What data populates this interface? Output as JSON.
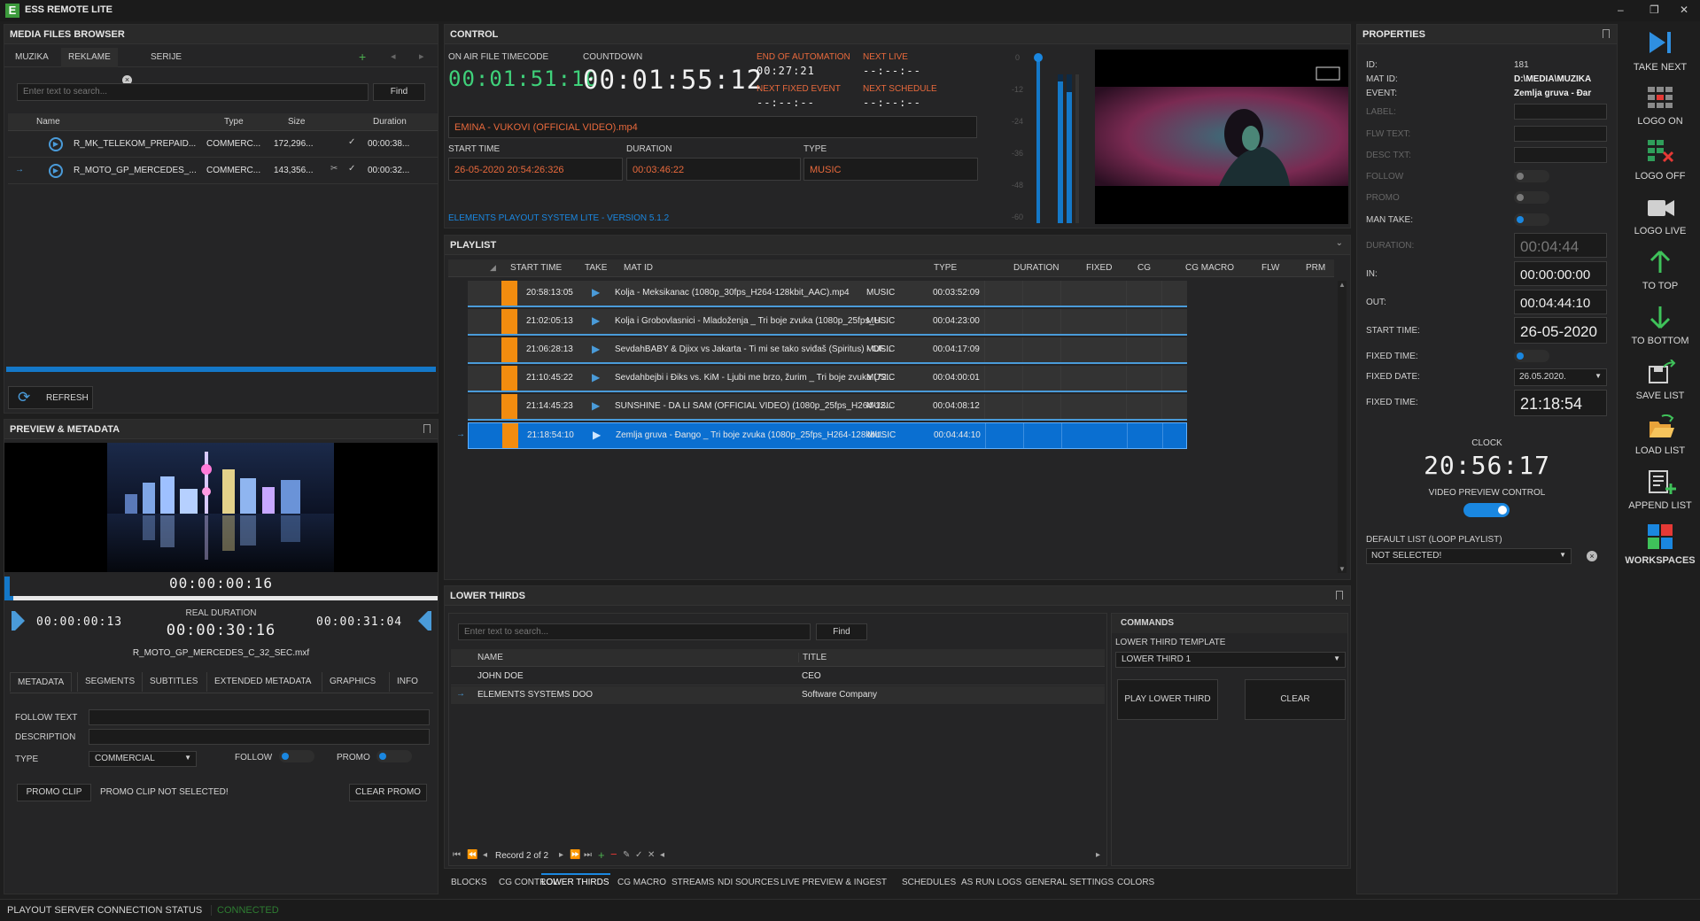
{
  "app": {
    "title": "ESS REMOTE LITE",
    "logo_letter": "E"
  },
  "window_controls": {
    "minimize": "–",
    "restore": "❐",
    "close": "✕"
  },
  "media_browser": {
    "title": "MEDIA FILES BROWSER",
    "tabs": [
      "MUZIKA",
      "REKLAME",
      "SERIJE"
    ],
    "search_placeholder": "Enter text to search...",
    "find_label": "Find",
    "columns": [
      "Name",
      "Type",
      "Size",
      "Duration"
    ],
    "rows": [
      {
        "name": "R_MK_TELEKOM_PREPAID...",
        "type": "COMMERC...",
        "size": "172,296...",
        "duration": "00:00:38..."
      },
      {
        "name": "R_MOTO_GP_MERCEDES_...",
        "type": "COMMERC...",
        "size": "143,356...",
        "duration": "00:00:32..."
      }
    ],
    "refresh_label": "REFRESH"
  },
  "preview": {
    "title": "PREVIEW & METADATA",
    "timecode": "00:00:00:16",
    "mark_in": "00:00:00:13",
    "real_duration_label": "REAL DURATION",
    "real_duration": "00:00:30:16",
    "mark_out": "00:00:31:04",
    "filename": "R_MOTO_GP_MERCEDES_C_32_SEC.mxf",
    "progress": 0.02,
    "tabs": [
      "METADATA",
      "SEGMENTS",
      "SUBTITLES",
      "EXTENDED METADATA",
      "GRAPHICS",
      "INFO"
    ],
    "follow_text_label": "FOLLOW TEXT",
    "description_label": "DESCRIPTION",
    "type_label": "TYPE",
    "type_value": "COMMERCIAL",
    "follow_label": "FOLLOW",
    "promo_label": "PROMO",
    "promo_clip_label": "PROMO CLIP",
    "promo_status": "PROMO CLIP NOT SELECTED!",
    "clear_promo_label": "CLEAR PROMO"
  },
  "control": {
    "title": "CONTROL",
    "on_air_label": "ON AIR FILE TIMECODE",
    "on_air": "00:01:51:10",
    "countdown_label": "COUNTDOWN",
    "countdown": "00:01:55:12",
    "end_automation_label": "END OF AUTOMATION",
    "end_automation": "00:27:21",
    "next_live_label": "NEXT LIVE",
    "next_live": "--:--:--",
    "next_fixed_label": "NEXT FIXED EVENT",
    "next_fixed": "--:--:--",
    "next_schedule_label": "NEXT SCHEDULE",
    "next_schedule": "--:--:--",
    "current_file": "EMINA - VUKOVI (OFFICIAL VIDEO).mp4",
    "start_time_label": "START TIME",
    "start_time": "26-05-2020 20:54:26:326",
    "duration_label": "DURATION",
    "duration": "00:03:46:22",
    "type_label": "TYPE",
    "type": "MUSIC",
    "version": "ELEMENTS PLAYOUT SYSTEM LITE - VERSION 5.1.2",
    "vu_scale": [
      "0",
      "-12",
      "-24",
      "-36",
      "-48",
      "-60"
    ],
    "vu_levels": [
      0.95,
      0.88
    ]
  },
  "playlist": {
    "title": "PLAYLIST",
    "columns": [
      "START TIME",
      "TAKE",
      "MAT ID",
      "TYPE",
      "DURATION",
      "FIXED",
      "CG",
      "CG MACRO",
      "FLW",
      "PRM"
    ],
    "rows": [
      {
        "start": "20:58:13:05",
        "mat": "Kolja - Meksikanac (1080p_30fps_H264-128kbit_AAC).mp4",
        "type": "MUSIC",
        "duration": "00:03:52:09"
      },
      {
        "start": "21:02:05:13",
        "mat": "Kolja i Grobovlasnici - Mladoženja _ Tri boje zvuka (1080p_25fps_H...",
        "type": "MUSIC",
        "duration": "00:04:23:00"
      },
      {
        "start": "21:06:28:13",
        "mat": "SevdahBABY & Djixx vs Jakarta - Ti mi se tako sviđaš (Spiritus) - OF...",
        "type": "MUSIC",
        "duration": "00:04:17:09"
      },
      {
        "start": "21:10:45:22",
        "mat": "Sevdahbejbi i Điks vs. KiM - Ljubi me brzo, žurim _ Tri boje zvuka (72...",
        "type": "MUSIC",
        "duration": "00:04:00:01"
      },
      {
        "start": "21:14:45:23",
        "mat": "SUNSHINE - DA LI SAM (OFFICIAL VIDEO) (1080p_25fps_H264-12...",
        "type": "MUSIC",
        "duration": "00:04:08:12"
      },
      {
        "start": "21:18:54:10",
        "mat": "Zemlja gruva - Đango _ Tri boje zvuka (1080p_25fps_H264-128kbit...",
        "type": "MUSIC",
        "duration": "00:04:44:10"
      }
    ]
  },
  "lower_thirds": {
    "title": "LOWER THIRDS",
    "search_placeholder": "Enter text to search...",
    "find_label": "Find",
    "columns": [
      "NAME",
      "TITLE"
    ],
    "rows": [
      {
        "name": "JOHN DOE",
        "title": "CEO"
      },
      {
        "name": "ELEMENTS SYSTEMS DOO",
        "title": "Software Company"
      }
    ],
    "record": "Record 2 of 2",
    "commands_label": "COMMANDS",
    "template_label": "LOWER THIRD TEMPLATE",
    "template_value": "LOWER THIRD 1",
    "play_label": "PLAY LOWER THIRD",
    "clear_label": "CLEAR"
  },
  "bottom_tabs": [
    "BLOCKS",
    "CG CONTROL",
    "LOWER THIRDS",
    "CG MACRO",
    "STREAMS",
    "NDI SOURCES",
    "LIVE PREVIEW & INGEST",
    "SCHEDULES",
    "AS RUN LOGS",
    "GENERAL SETTINGS",
    "COLORS"
  ],
  "properties": {
    "title": "PROPERTIES",
    "id_label": "ID:",
    "id": "181",
    "mat_id_label": "MAT ID:",
    "mat_id": "D:\\MEDIA\\MUZIKA",
    "event_label": "EVENT:",
    "event": "Zemlja gruva - Đar",
    "label_label": "LABEL:",
    "flw_text_label": "FLW TEXT:",
    "desc_txt_label": "DESC TXT:",
    "follow_label": "FOLLOW",
    "promo_label": "PROMO",
    "man_take_label": "MAN TAKE:",
    "duration_label": "DURATION:",
    "duration": "00:04:44",
    "in_label": "IN:",
    "in": "00:00:00:00",
    "out_label": "OUT:",
    "out": "00:04:44:10",
    "start_time_label": "START TIME:",
    "start_time": "26-05-2020",
    "fixed_time_label": "FIXED TIME:",
    "fixed_date_label": "FIXED DATE:",
    "fixed_date": "26.05.2020.",
    "fixed_time2_label": "FIXED TIME:",
    "fixed_time": "21:18:54",
    "clock_label": "CLOCK",
    "clock": "20:56:17",
    "video_preview_label": "VIDEO PREVIEW CONTROL",
    "default_list_label": "DEFAULT LIST (LOOP PLAYLIST)",
    "default_list_value": "NOT SELECTED!"
  },
  "sidebar": [
    {
      "label": "TAKE NEXT",
      "icon": "take-next-icon"
    },
    {
      "label": "LOGO ON",
      "icon": "logo-on-icon"
    },
    {
      "label": "LOGO OFF",
      "icon": "logo-off-icon"
    },
    {
      "label": "LOGO LIVE",
      "icon": "logo-live-icon"
    },
    {
      "label": "TO TOP",
      "icon": "arrow-up-icon"
    },
    {
      "label": "TO BOTTOM",
      "icon": "arrow-down-icon"
    },
    {
      "label": "SAVE LIST",
      "icon": "save-list-icon"
    },
    {
      "label": "LOAD LIST",
      "icon": "load-list-icon"
    },
    {
      "label": "APPEND LIST",
      "icon": "append-list-icon"
    },
    {
      "label": "WORKSPACES",
      "icon": "workspaces-icon"
    }
  ],
  "status": {
    "label": "PLAYOUT SERVER CONNECTION STATUS",
    "value": "CONNECTED",
    "value_color": "#2e7d32"
  },
  "colors": {
    "accent": "#0078d7",
    "orange": "#f28c0f",
    "red_label": "#e8693c"
  }
}
